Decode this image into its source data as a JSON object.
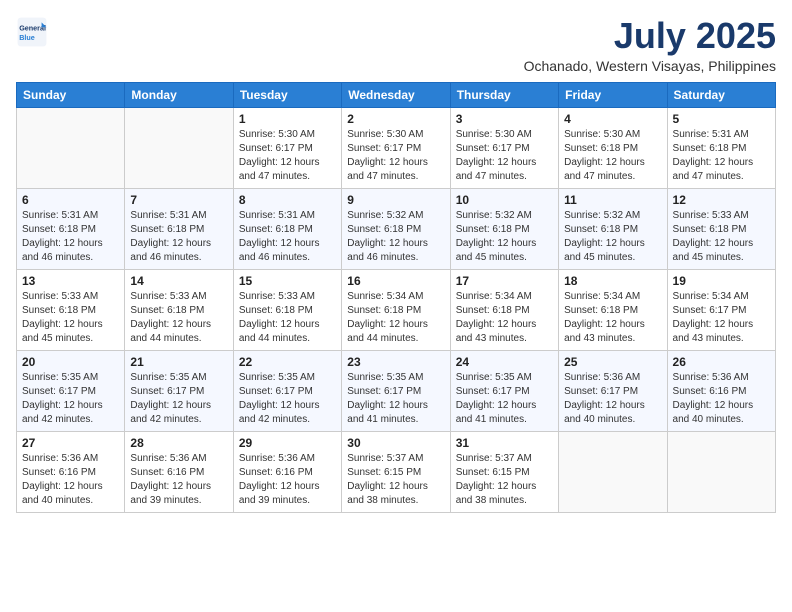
{
  "logo": {
    "line1": "General",
    "line2": "Blue"
  },
  "title": "July 2025",
  "location": "Ochanado, Western Visayas, Philippines",
  "days_header": [
    "Sunday",
    "Monday",
    "Tuesday",
    "Wednesday",
    "Thursday",
    "Friday",
    "Saturday"
  ],
  "weeks": [
    [
      {
        "day": "",
        "info": ""
      },
      {
        "day": "",
        "info": ""
      },
      {
        "day": "1",
        "info": "Sunrise: 5:30 AM\nSunset: 6:17 PM\nDaylight: 12 hours and 47 minutes."
      },
      {
        "day": "2",
        "info": "Sunrise: 5:30 AM\nSunset: 6:17 PM\nDaylight: 12 hours and 47 minutes."
      },
      {
        "day": "3",
        "info": "Sunrise: 5:30 AM\nSunset: 6:17 PM\nDaylight: 12 hours and 47 minutes."
      },
      {
        "day": "4",
        "info": "Sunrise: 5:30 AM\nSunset: 6:18 PM\nDaylight: 12 hours and 47 minutes."
      },
      {
        "day": "5",
        "info": "Sunrise: 5:31 AM\nSunset: 6:18 PM\nDaylight: 12 hours and 47 minutes."
      }
    ],
    [
      {
        "day": "6",
        "info": "Sunrise: 5:31 AM\nSunset: 6:18 PM\nDaylight: 12 hours and 46 minutes."
      },
      {
        "day": "7",
        "info": "Sunrise: 5:31 AM\nSunset: 6:18 PM\nDaylight: 12 hours and 46 minutes."
      },
      {
        "day": "8",
        "info": "Sunrise: 5:31 AM\nSunset: 6:18 PM\nDaylight: 12 hours and 46 minutes."
      },
      {
        "day": "9",
        "info": "Sunrise: 5:32 AM\nSunset: 6:18 PM\nDaylight: 12 hours and 46 minutes."
      },
      {
        "day": "10",
        "info": "Sunrise: 5:32 AM\nSunset: 6:18 PM\nDaylight: 12 hours and 45 minutes."
      },
      {
        "day": "11",
        "info": "Sunrise: 5:32 AM\nSunset: 6:18 PM\nDaylight: 12 hours and 45 minutes."
      },
      {
        "day": "12",
        "info": "Sunrise: 5:33 AM\nSunset: 6:18 PM\nDaylight: 12 hours and 45 minutes."
      }
    ],
    [
      {
        "day": "13",
        "info": "Sunrise: 5:33 AM\nSunset: 6:18 PM\nDaylight: 12 hours and 45 minutes."
      },
      {
        "day": "14",
        "info": "Sunrise: 5:33 AM\nSunset: 6:18 PM\nDaylight: 12 hours and 44 minutes."
      },
      {
        "day": "15",
        "info": "Sunrise: 5:33 AM\nSunset: 6:18 PM\nDaylight: 12 hours and 44 minutes."
      },
      {
        "day": "16",
        "info": "Sunrise: 5:34 AM\nSunset: 6:18 PM\nDaylight: 12 hours and 44 minutes."
      },
      {
        "day": "17",
        "info": "Sunrise: 5:34 AM\nSunset: 6:18 PM\nDaylight: 12 hours and 43 minutes."
      },
      {
        "day": "18",
        "info": "Sunrise: 5:34 AM\nSunset: 6:18 PM\nDaylight: 12 hours and 43 minutes."
      },
      {
        "day": "19",
        "info": "Sunrise: 5:34 AM\nSunset: 6:17 PM\nDaylight: 12 hours and 43 minutes."
      }
    ],
    [
      {
        "day": "20",
        "info": "Sunrise: 5:35 AM\nSunset: 6:17 PM\nDaylight: 12 hours and 42 minutes."
      },
      {
        "day": "21",
        "info": "Sunrise: 5:35 AM\nSunset: 6:17 PM\nDaylight: 12 hours and 42 minutes."
      },
      {
        "day": "22",
        "info": "Sunrise: 5:35 AM\nSunset: 6:17 PM\nDaylight: 12 hours and 42 minutes."
      },
      {
        "day": "23",
        "info": "Sunrise: 5:35 AM\nSunset: 6:17 PM\nDaylight: 12 hours and 41 minutes."
      },
      {
        "day": "24",
        "info": "Sunrise: 5:35 AM\nSunset: 6:17 PM\nDaylight: 12 hours and 41 minutes."
      },
      {
        "day": "25",
        "info": "Sunrise: 5:36 AM\nSunset: 6:17 PM\nDaylight: 12 hours and 40 minutes."
      },
      {
        "day": "26",
        "info": "Sunrise: 5:36 AM\nSunset: 6:16 PM\nDaylight: 12 hours and 40 minutes."
      }
    ],
    [
      {
        "day": "27",
        "info": "Sunrise: 5:36 AM\nSunset: 6:16 PM\nDaylight: 12 hours and 40 minutes."
      },
      {
        "day": "28",
        "info": "Sunrise: 5:36 AM\nSunset: 6:16 PM\nDaylight: 12 hours and 39 minutes."
      },
      {
        "day": "29",
        "info": "Sunrise: 5:36 AM\nSunset: 6:16 PM\nDaylight: 12 hours and 39 minutes."
      },
      {
        "day": "30",
        "info": "Sunrise: 5:37 AM\nSunset: 6:15 PM\nDaylight: 12 hours and 38 minutes."
      },
      {
        "day": "31",
        "info": "Sunrise: 5:37 AM\nSunset: 6:15 PM\nDaylight: 12 hours and 38 minutes."
      },
      {
        "day": "",
        "info": ""
      },
      {
        "day": "",
        "info": ""
      }
    ]
  ]
}
